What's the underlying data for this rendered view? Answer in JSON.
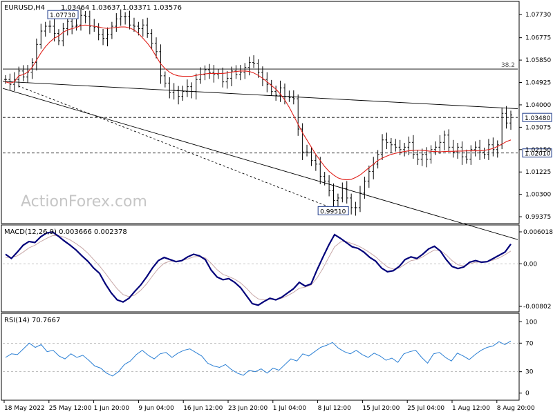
{
  "header": {
    "symbol": "EURUSD,H4",
    "ohlc": "1.03464 1.03637 1.03371 1.03576"
  },
  "watermark": "ActionForex.com",
  "colors": {
    "price_bar": "#000000",
    "moving_average": "#e0201a",
    "macd_main": "#00007a",
    "macd_signal": "#c8a8a8",
    "rsi": "#2a7fd4",
    "level_box": "#1e3a8a",
    "grid_dash": "#9a9a9a"
  },
  "chart_data": [
    {
      "type": "line",
      "panel": "price",
      "title": "EURUSD,H4",
      "ylim": [
        0.9915,
        1.0822
      ],
      "y_ticks": [
        1.0773,
        1.06775,
        1.0585,
        1.04925,
        1.04,
        1.03075,
        1.0215,
        1.01225,
        1.003,
        0.99375
      ],
      "y_tick_labels": [
        "1.07730",
        "1.06775",
        "1.05850",
        "1.04925",
        "1.04000",
        "1.03075",
        "1.02150",
        "1.01225",
        "1.00300",
        "0.99375"
      ],
      "x_tick_labels": [
        "18 May 2022",
        "25 May 12:00",
        "1 Jun 20:00",
        "9 Jun 04:00",
        "16 Jun 12:00",
        "23 Jun 20:00",
        "1 Jul 04:00",
        "8 Jul 12:00",
        "15 Jul 20:00",
        "25 Jul 04:00",
        "1 Aug 12:00",
        "8 Aug 20:00"
      ],
      "series": [
        {
          "values": [
            1.0505,
            1.0485,
            1.0505,
            1.054,
            1.0515,
            1.0535,
            1.0575,
            1.065,
            1.0705,
            1.0725,
            1.0725,
            1.0695,
            1.0665,
            1.0715,
            1.0745,
            1.0725,
            1.073,
            1.077,
            1.0765,
            1.0725,
            1.072,
            1.069,
            1.0675,
            1.069,
            1.0725,
            1.0755,
            1.0765,
            1.0765,
            1.073,
            1.0725,
            1.0715,
            1.073,
            1.0695,
            1.0655,
            1.062,
            1.052,
            1.049,
            1.045,
            1.046,
            1.0435,
            1.0455,
            1.0475,
            1.0455,
            1.0505,
            1.0525,
            1.0545,
            1.0535,
            1.0525,
            1.053,
            1.0495,
            1.051,
            1.054,
            1.0525,
            1.0535,
            1.0555,
            1.0575,
            1.057,
            1.0535,
            1.0505,
            1.0485,
            1.0455,
            1.044,
            1.047,
            1.0435,
            1.043,
            1.0425,
            1.03,
            1.0205,
            1.0205,
            1.017,
            1.0155,
            1.0105,
            1.0085,
            1.0045,
            1.0005,
            1.0015,
            1.0055,
            1.0015,
            0.9975,
            0.9975,
            1.0035,
            1.0085,
            1.0125,
            1.0155,
            1.0195,
            1.0255,
            1.0245,
            1.0235,
            1.0225,
            1.0215,
            1.0225,
            1.0245,
            1.0195,
            1.0175,
            1.0195,
            1.0175,
            1.0215,
            1.0225,
            1.0245,
            1.0275,
            1.0225,
            1.0205,
            1.0225,
            1.0185,
            1.0175,
            1.0215,
            1.0225,
            1.0205,
            1.0195,
            1.0235,
            1.0215,
            1.0235,
            1.0365,
            1.0325,
            1.0358
          ]
        },
        {
          "name": "MA",
          "values": [
            1.0495,
            1.049,
            1.0495,
            1.052,
            1.0525,
            1.0535,
            1.0555,
            1.0585,
            1.0615,
            1.064,
            1.066,
            1.0675,
            1.0685,
            1.07,
            1.071,
            1.0715,
            1.072,
            1.0728,
            1.073,
            1.0728,
            1.0725,
            1.0722,
            1.0718,
            1.0716,
            1.0718,
            1.072,
            1.0722,
            1.0722,
            1.0718,
            1.071,
            1.0695,
            1.0675,
            1.0655,
            1.063,
            1.06,
            1.057,
            1.055,
            1.0535,
            1.0525,
            1.052,
            1.0518,
            1.0518,
            1.0518,
            1.0522,
            1.0525,
            1.0528,
            1.053,
            1.053,
            1.053,
            1.053,
            1.0532,
            1.0535,
            1.0538,
            1.054,
            1.054,
            1.0538,
            1.0532,
            1.0522,
            1.051,
            1.0495,
            1.048,
            1.0465,
            1.0445,
            1.042,
            1.039,
            1.0355,
            1.032,
            1.0285,
            1.0255,
            1.0225,
            1.0195,
            1.017,
            1.0145,
            1.0125,
            1.011,
            1.0098,
            1.0092,
            1.009,
            1.0092,
            1.01,
            1.011,
            1.0125,
            1.014,
            1.0155,
            1.017,
            1.018,
            1.0188,
            1.0195,
            1.02,
            1.0204,
            1.0207,
            1.021,
            1.0212,
            1.0213,
            1.0212,
            1.021,
            1.0208,
            1.0207,
            1.0206,
            1.0207,
            1.0208,
            1.0208,
            1.0209,
            1.0209,
            1.021,
            1.021,
            1.021,
            1.021,
            1.0212,
            1.0215,
            1.022,
            1.0228,
            1.0238,
            1.0248,
            1.0255
          ]
        }
      ],
      "levels": [
        {
          "value": 1.0773,
          "label": "1.07730",
          "style": "marker"
        },
        {
          "value": 1.0548,
          "label": "38.2",
          "style": "solid"
        },
        {
          "value": 1.0348,
          "label": "1.03480",
          "style": "dashed"
        },
        {
          "value": 1.0201,
          "label": "1.02010",
          "style": "dashed"
        },
        {
          "value": 0.9951,
          "label": "0.99510",
          "style": "marker"
        }
      ],
      "trendlines": [
        {
          "from": [
            0.0,
            1.0468
          ],
          "to": [
            1.0,
            0.9843
          ],
          "style": "solid"
        },
        {
          "from": [
            0.03,
            1.0478
          ],
          "to": [
            0.67,
            0.9948
          ],
          "style": "dashed"
        },
        {
          "from": [
            0.0,
            1.0497
          ],
          "to": [
            1.0,
            1.0384
          ],
          "style": "solid"
        }
      ]
    },
    {
      "type": "line",
      "panel": "macd",
      "title": "MACD(12,26,9) 0.003666 0.002378",
      "ylim": [
        -0.0088,
        0.0068
      ],
      "y_ticks": [
        0.006018,
        0.0,
        -0.00802
      ],
      "y_tick_labels": [
        "0.006018",
        "0.00",
        "-0.00802"
      ],
      "series": [
        {
          "name": "MACD",
          "values": [
            0.0018,
            0.001,
            0.0022,
            0.0035,
            0.0042,
            0.004,
            0.0051,
            0.0058,
            0.006,
            0.0052,
            0.0043,
            0.0035,
            0.0026,
            0.0015,
            0.0005,
            -0.0008,
            -0.0018,
            -0.0038,
            -0.0055,
            -0.0068,
            -0.0072,
            -0.0065,
            -0.0052,
            -0.004,
            -0.0025,
            -0.0008,
            0.0006,
            0.0012,
            0.0008,
            0.0004,
            0.0006,
            0.0013,
            0.0018,
            0.0015,
            0.0008,
            -0.0012,
            -0.0025,
            -0.003,
            -0.0028,
            -0.0035,
            -0.0045,
            -0.006,
            -0.0075,
            -0.0078,
            -0.0071,
            -0.0065,
            -0.0068,
            -0.0063,
            -0.0055,
            -0.0047,
            -0.0035,
            -0.0042,
            -0.0038,
            -0.0012,
            0.0012,
            0.0035,
            0.0055,
            0.0048,
            0.004,
            0.0032,
            0.0029,
            0.0022,
            0.0012,
            0.0005,
            -0.0008,
            -0.0015,
            -0.0013,
            -0.0005,
            0.0008,
            0.0013,
            0.001,
            0.0018,
            0.0028,
            0.0033,
            0.0024,
            0.0008,
            -0.0005,
            -0.0009,
            -0.0006,
            0.0003,
            0.0006,
            0.0003,
            0.0004,
            0.001,
            0.0016,
            0.0022,
            0.0037
          ]
        },
        {
          "name": "Signal",
          "values": [
            0.0012,
            0.0012,
            0.0015,
            0.0022,
            0.003,
            0.0035,
            0.0042,
            0.0048,
            0.0053,
            0.0053,
            0.005,
            0.0045,
            0.0038,
            0.003,
            0.002,
            0.0008,
            -0.0004,
            -0.0018,
            -0.0033,
            -0.0047,
            -0.0058,
            -0.0062,
            -0.0059,
            -0.005,
            -0.0038,
            -0.0023,
            -0.0009,
            0.0001,
            0.0005,
            0.0005,
            0.0006,
            0.0009,
            0.0013,
            0.0014,
            0.0011,
            0.0001,
            -0.0011,
            -0.002,
            -0.0024,
            -0.0029,
            -0.0036,
            -0.0046,
            -0.0058,
            -0.0066,
            -0.0068,
            -0.0067,
            -0.0067,
            -0.0065,
            -0.006,
            -0.0054,
            -0.0046,
            -0.0044,
            -0.004,
            -0.0027,
            -0.0009,
            0.0012,
            0.0032,
            0.0041,
            0.0042,
            0.0038,
            0.0034,
            0.0028,
            0.0021,
            0.0013,
            0.0003,
            -0.0006,
            -0.001,
            -0.0008,
            -0.0001,
            0.0006,
            0.0008,
            0.0013,
            0.002,
            0.0026,
            0.0025,
            0.0017,
            0.0006,
            -0.0002,
            -0.0004,
            0.0,
            0.0003,
            0.0003,
            0.0004,
            0.0007,
            0.0011,
            0.0017,
            0.0024
          ]
        }
      ]
    },
    {
      "type": "line",
      "panel": "rsi",
      "title": "RSI(14) 70.7667",
      "ylim": [
        0,
        100
      ],
      "y_ticks": [
        100,
        70,
        30,
        0
      ],
      "y_tick_labels": [
        "100",
        "70",
        "30",
        "0"
      ],
      "series": [
        {
          "name": "RSI",
          "values": [
            50,
            55,
            54,
            62,
            70,
            64,
            68,
            58,
            60,
            52,
            48,
            55,
            50,
            53,
            46,
            38,
            35,
            28,
            24,
            30,
            40,
            45,
            54,
            60,
            53,
            48,
            55,
            57,
            50,
            56,
            60,
            62,
            57,
            52,
            42,
            38,
            36,
            40,
            33,
            28,
            25,
            32,
            30,
            34,
            28,
            35,
            32,
            40,
            48,
            45,
            55,
            52,
            58,
            64,
            67,
            71,
            63,
            58,
            55,
            60,
            54,
            50,
            56,
            52,
            46,
            49,
            43,
            55,
            58,
            60,
            50,
            42,
            55,
            57,
            50,
            45,
            56,
            52,
            47,
            54,
            60,
            64,
            66,
            72,
            68,
            73
          ]
        }
      ]
    }
  ]
}
